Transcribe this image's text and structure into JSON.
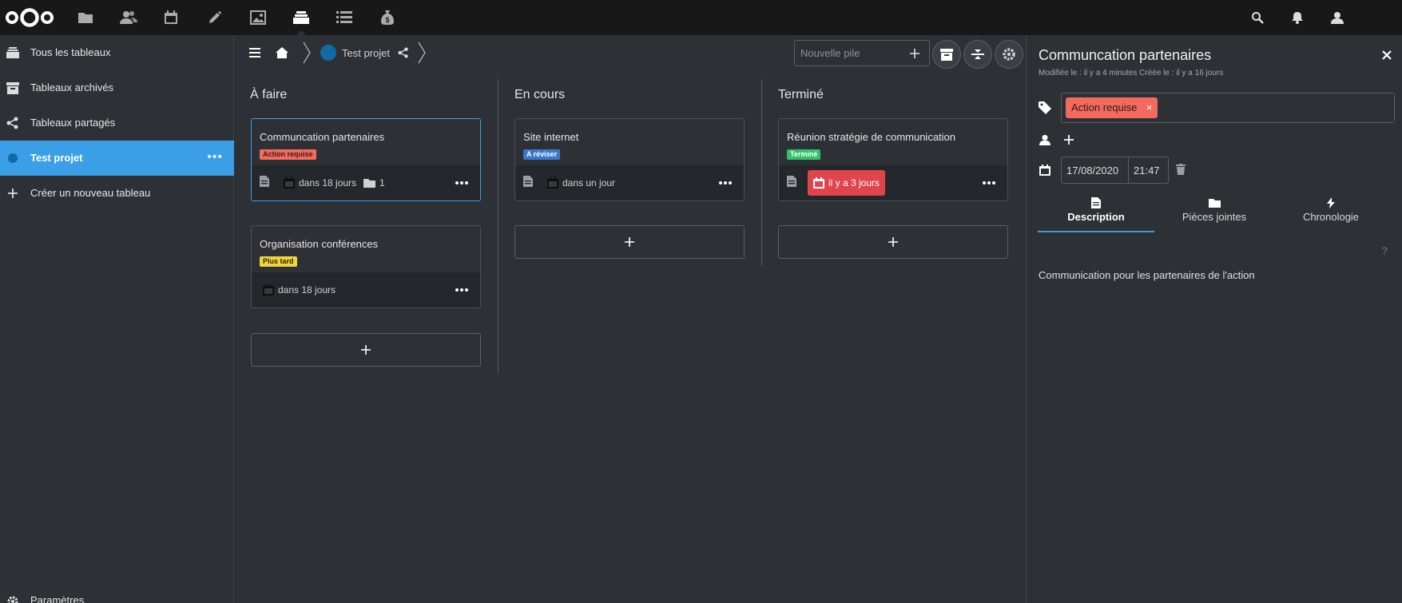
{
  "header": {
    "apps": [
      "files-icon",
      "contacts-icon",
      "calendar-icon",
      "notes-icon",
      "photos-icon",
      "deck-icon",
      "tasks-icon",
      "money-icon"
    ],
    "active_app": "deck-icon"
  },
  "nav": {
    "items": [
      {
        "label": "Tous les tableaux",
        "icon": "deck-icon"
      },
      {
        "label": "Tableaux archivés",
        "icon": "archive-icon"
      },
      {
        "label": "Tableaux partagés",
        "icon": "share-icon"
      },
      {
        "label": "Test projet",
        "icon": "board-dot",
        "active": true
      },
      {
        "label": "Créer un nouveau tableau",
        "icon": "plus-icon"
      }
    ],
    "settings_label": "Paramètres"
  },
  "toolbar": {
    "board_title": "Test projet",
    "new_stack_placeholder": "Nouvelle pile"
  },
  "stacks": [
    {
      "title": "À faire",
      "cards": [
        {
          "title": "Communcation partenaires",
          "label": "Action requise",
          "label_color": "#f36a5f",
          "due": "dans 18 jours",
          "attachments": "1",
          "selected": true
        },
        {
          "title": "Organisation conférences",
          "label": "Plus tard",
          "label_color": "#f2d53c",
          "due": "dans 18 jours"
        }
      ]
    },
    {
      "title": "En cours",
      "cards": [
        {
          "title": "Site internet",
          "label": "A réviser",
          "label_color": "#3a77c9",
          "due": "dans un jour"
        }
      ]
    },
    {
      "title": "Terminé",
      "cards": [
        {
          "title": "Réunion stratégie de communication",
          "label": "Terminé",
          "label_color": "#31c067",
          "due": "il y a 3 jours",
          "overdue": true
        }
      ]
    }
  ],
  "sidebar": {
    "title": "Communcation partenaires",
    "subtitle": "Modifiée le : il y a 4 minutes Créée le : il y a 16 jours",
    "tag": "Action requise",
    "tag_remove": "×",
    "due_date": "17/08/2020",
    "due_time": "21:47",
    "tabs": [
      {
        "label": "Description",
        "active": true
      },
      {
        "label": "Pièces jointes"
      },
      {
        "label": "Chronologie"
      }
    ],
    "help": "?",
    "description": "Communication pour les partenaires de l'action"
  },
  "colors": {
    "accent": "#3a9fe6",
    "header_bg": "#181818",
    "page_bg": "#2d3136",
    "overdue": "#e0444d"
  }
}
